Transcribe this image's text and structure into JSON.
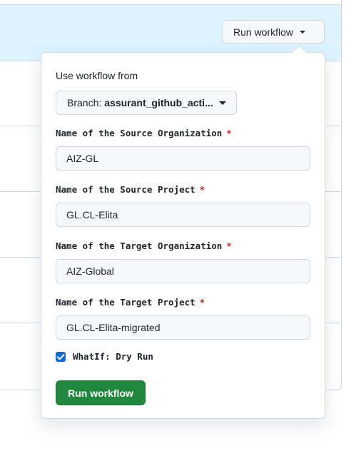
{
  "header": {
    "run_workflow_label": "Run workflow"
  },
  "dialog": {
    "use_workflow_from": "Use workflow from",
    "branch_prefix": "Branch:",
    "branch_name": "assurant_github_acti...",
    "fields": [
      {
        "label": "Name of the Source Organization",
        "required": "*",
        "value": "AIZ-GL"
      },
      {
        "label": "Name of the Source Project",
        "required": "*",
        "value": "GL.CL-Elita"
      },
      {
        "label": "Name of the Target Organization",
        "required": "*",
        "value": "AIZ-Global"
      },
      {
        "label": "Name of the Target Project",
        "required": "*",
        "value": "GL.CL-Elita-migrated"
      }
    ],
    "whatif_label": "WhatIf: Dry Run",
    "whatif_checked": true,
    "submit_label": "Run workflow"
  },
  "colors": {
    "header_bg": "#ddf4ff",
    "submit_bg": "#1f883d",
    "required": "#cf222e",
    "checkbox": "#0969da"
  }
}
